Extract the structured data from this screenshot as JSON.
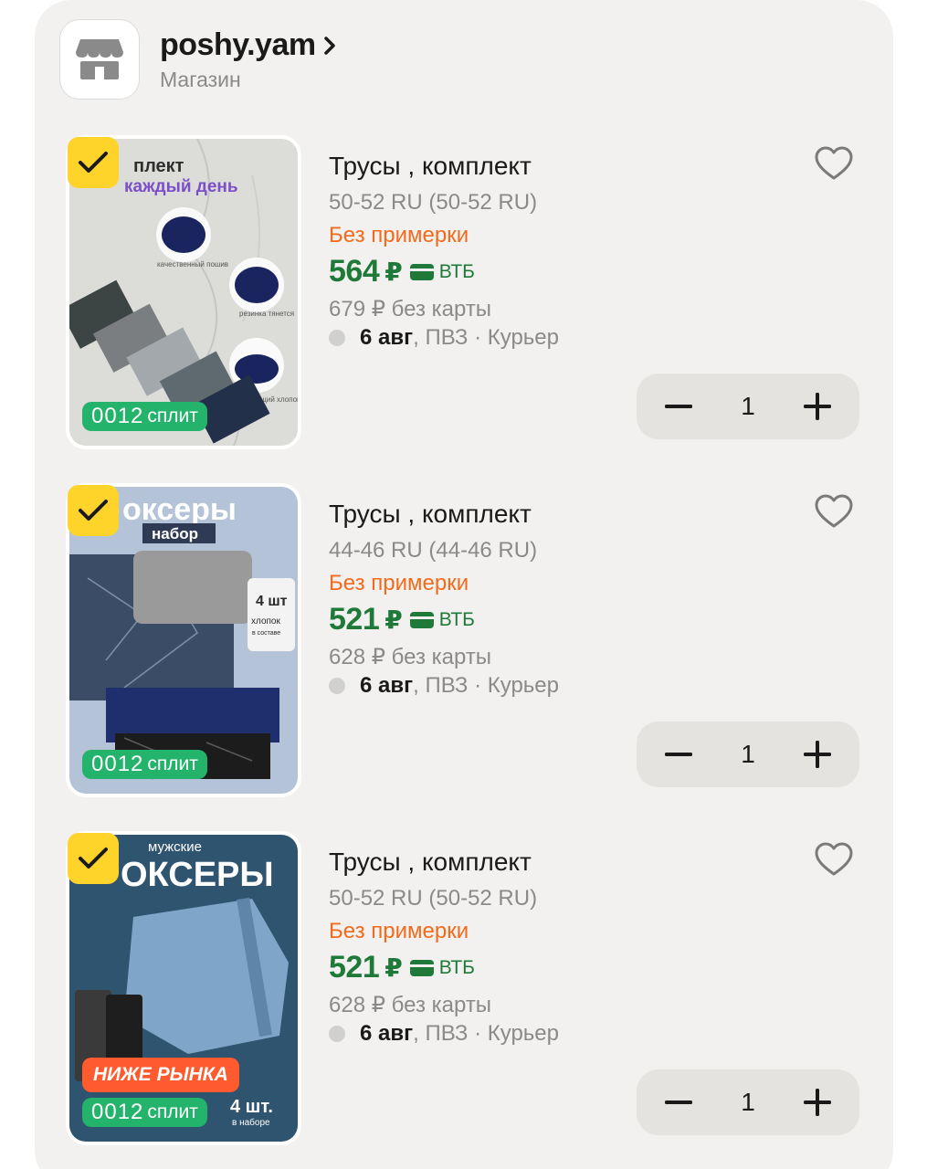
{
  "store": {
    "name": "poshy.yam",
    "type": "Магазин"
  },
  "items": [
    {
      "title": "Трусы , комплект",
      "size": "50-52 RU (50-52 RU)",
      "tryon": "Без примерки",
      "price": "564",
      "currency": "₽",
      "bank": "ВТБ",
      "old_price": "679 ₽  без карты",
      "delivery_date": "6 авг",
      "delivery_rest": ", ПВЗ · Курьер",
      "qty": "1",
      "split_digits": "0012",
      "split_label": "сплит",
      "image_text": [
        "плект",
        "каждый день",
        "качественный пошив",
        "резинка тянется",
        "дышащий хлопок"
      ]
    },
    {
      "title": "Трусы , комплект",
      "size": "44-46 RU (44-46 RU)",
      "tryon": "Без примерки",
      "price": "521",
      "currency": "₽",
      "bank": "ВТБ",
      "old_price": "628 ₽  без карты",
      "delivery_date": "6 авг",
      "delivery_rest": ", ПВЗ · Курьер",
      "qty": "1",
      "split_digits": "0012",
      "split_label": "сплит",
      "image_text": [
        "оксеры",
        "набор",
        "4 шт",
        "хлопок",
        "в составе"
      ]
    },
    {
      "title": "Трусы , комплект",
      "size": "50-52 RU (50-52 RU)",
      "tryon": "Без примерки",
      "price": "521",
      "currency": "₽",
      "bank": "ВТБ",
      "old_price": "628 ₽  без карты",
      "delivery_date": "6 авг",
      "delivery_rest": ", ПВЗ · Курьер",
      "qty": "1",
      "split_digits": "0012",
      "split_label": "сплит",
      "badge": "НИЖЕ РЫНКА",
      "image_text": [
        "мужские",
        "ОКСЕРЫ",
        "4 шт.",
        "в наборе"
      ]
    }
  ],
  "colors": {
    "accent_yellow": "#fed42b",
    "price_green": "#1f7a3a",
    "split_green": "#24b36b",
    "tryon_orange": "#f26b1d",
    "card_bg": "#f2f1ef"
  }
}
